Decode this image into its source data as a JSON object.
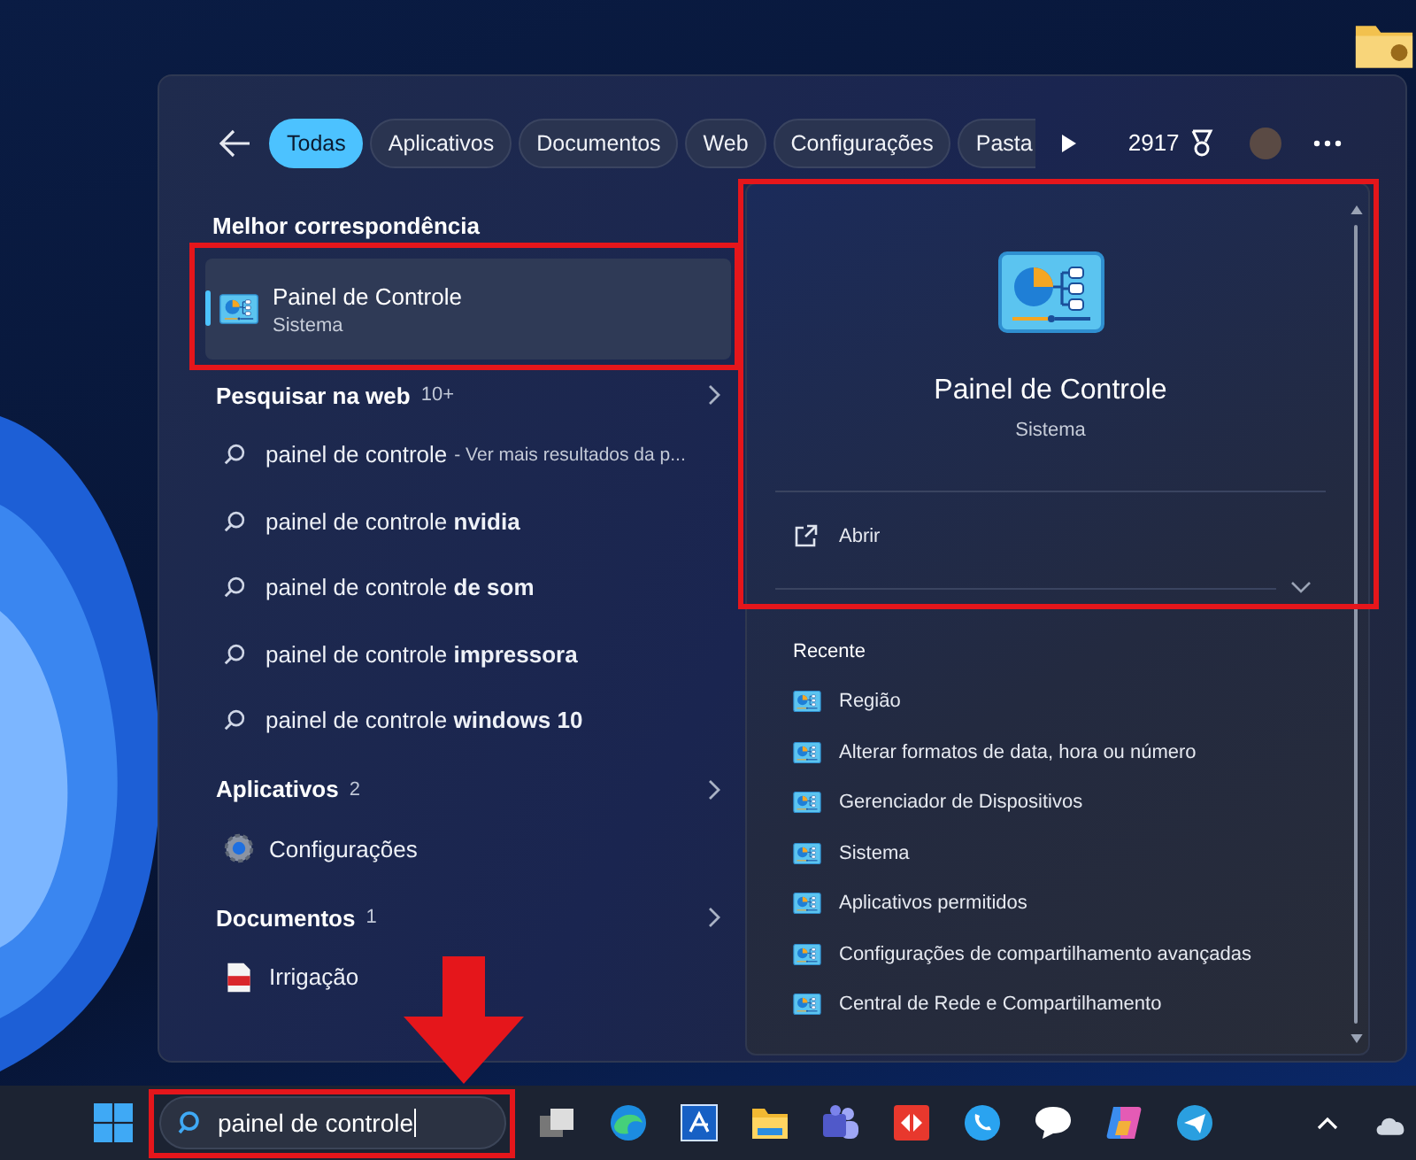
{
  "search_panel": {
    "tabs": [
      {
        "label": "Todas",
        "selected": true
      },
      {
        "label": "Aplicativos",
        "selected": false
      },
      {
        "label": "Documentos",
        "selected": false
      },
      {
        "label": "Web",
        "selected": false
      },
      {
        "label": "Configurações",
        "selected": false
      },
      {
        "label": "Pasta",
        "selected": false
      }
    ],
    "points": "2917",
    "best_match": {
      "heading": "Melhor correspondência",
      "title": "Painel de Controle",
      "subtitle": "Sistema",
      "selected": true
    },
    "web": {
      "heading": "Pesquisar na web",
      "count": "10+",
      "results": [
        {
          "query": "painel de controle",
          "hint": "- Ver mais resultados da p..."
        },
        {
          "query": "painel de controle **nvidia**"
        },
        {
          "query": "painel de controle **de som**"
        },
        {
          "query": "painel de controle **impressora**"
        },
        {
          "query": "painel de controle **windows 10**"
        }
      ]
    },
    "apps": {
      "heading": "Aplicativos",
      "count": "2",
      "items": [
        {
          "label": "Configurações"
        }
      ]
    },
    "documents": {
      "heading": "Documentos",
      "count": "1",
      "items": [
        {
          "label": "Irrigação"
        }
      ]
    },
    "preview": {
      "title": "Painel de Controle",
      "subtitle": "Sistema",
      "action": "Abrir",
      "recent_heading": "Recente",
      "recent": [
        "Região",
        "Alterar formatos de data, hora ou número",
        "Gerenciador de Dispositivos",
        "Sistema",
        "Aplicativos permitidos",
        "Configurações de compartilhamento avançadas",
        "Central de Rede e Compartilhamento"
      ]
    }
  },
  "taskbar": {
    "search": {
      "value": "painel de controle"
    }
  }
}
